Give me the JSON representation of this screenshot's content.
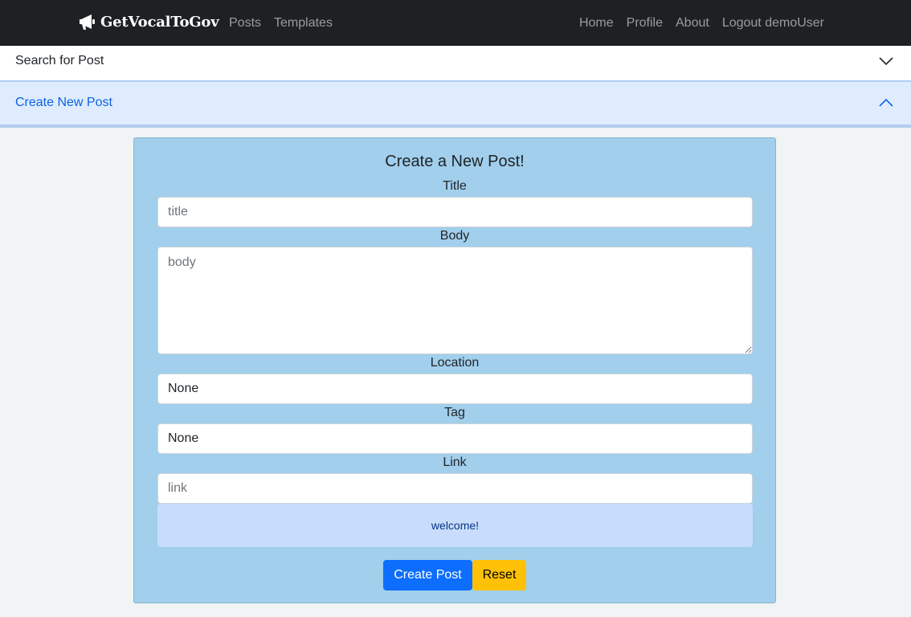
{
  "navbar": {
    "brand": "GetVocalToGov",
    "left_links": [
      "Posts",
      "Templates"
    ],
    "right_links": [
      "Home",
      "Profile",
      "About",
      "Logout demoUser"
    ]
  },
  "accordion": {
    "search_label": "Search for Post",
    "create_label": "Create New Post"
  },
  "form": {
    "heading": "Create a New Post!",
    "title_label": "Title",
    "title_placeholder": "title",
    "body_label": "Body",
    "body_placeholder": "body",
    "location_label": "Location",
    "location_value": "None",
    "tag_label": "Tag",
    "tag_value": "None",
    "link_label": "Link",
    "link_placeholder": "link",
    "alert_text": "welcome!",
    "submit_label": "Create Post",
    "reset_label": "Reset"
  },
  "icons": {
    "brand_icon": "megaphone-icon",
    "collapsed_chevron": "chevron-down-icon",
    "expanded_chevron": "chevron-up-icon"
  },
  "colors": {
    "navbar_bg": "#1d2124",
    "card_bg": "#a1cfec",
    "primary": "#0d6efd",
    "warning": "#ffc107",
    "alert_bg": "#c8ddfc",
    "accordion_active_bg": "#dfecfd"
  }
}
